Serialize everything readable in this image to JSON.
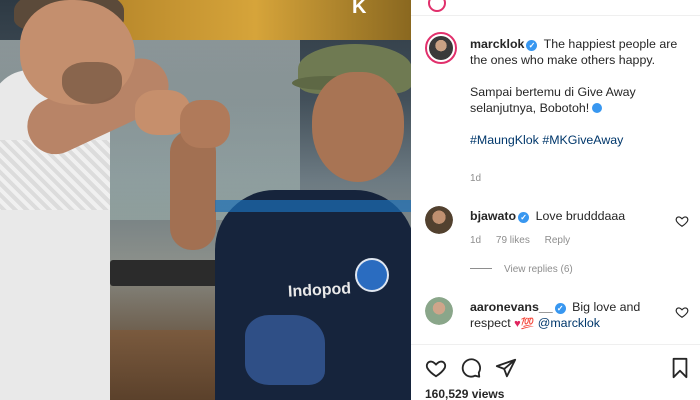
{
  "post": {
    "watermark": "K",
    "caption": {
      "username": "marcklok",
      "lines": [
        "The happiest people are the ones who make others happy."
      ],
      "line2": "Sampai bertemu di Give Away selanjutnya, Bobotoh!",
      "hashtags": "#MaungKlok #MKGiveAway",
      "time": "1d"
    },
    "comments": [
      {
        "username": "bjawato",
        "text": "Love brudddaaa",
        "time": "1d",
        "likes": "79 likes",
        "reply_label": "Reply",
        "view_replies": "View replies (6)"
      },
      {
        "username": "aaronevans__",
        "text": "Big love and respect",
        "mention": "@marcklok"
      }
    ],
    "views": "160,529 views",
    "icons": {
      "like": "heart-icon",
      "comment": "comment-icon",
      "share": "share-icon",
      "save": "bookmark-icon"
    },
    "colors": {
      "verified": "#3897f0",
      "hashtag": "#00376b",
      "story_ring": "#e1306c"
    }
  }
}
